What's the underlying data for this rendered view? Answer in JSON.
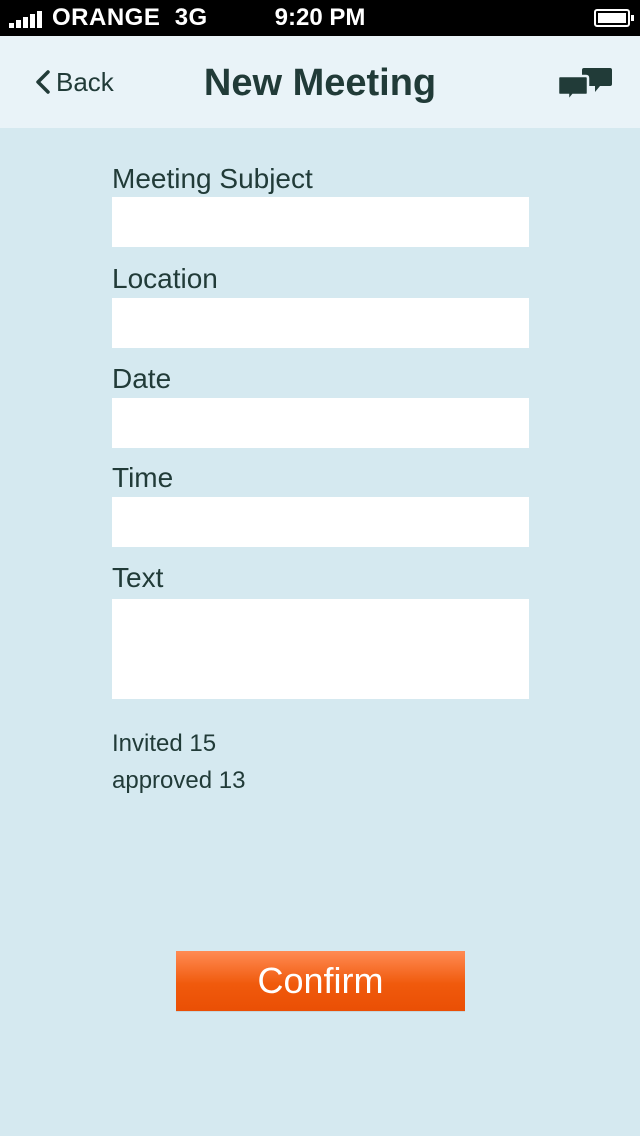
{
  "status_bar": {
    "carrier": "ORANGE",
    "network": "3G",
    "time": "9:20 PM",
    "signal_bars": 5,
    "battery_level": 1.0
  },
  "nav": {
    "back_label": "Back",
    "title": "New Meeting",
    "right_icon": "chat-bubbles-icon"
  },
  "form": {
    "fields": [
      {
        "label": "Meeting Subject",
        "value": "",
        "placeholder": ""
      },
      {
        "label": "Location",
        "value": "",
        "placeholder": ""
      },
      {
        "label": "Date",
        "value": "",
        "placeholder": ""
      },
      {
        "label": "Time",
        "value": "",
        "placeholder": ""
      },
      {
        "label": "Text",
        "value": "",
        "placeholder": ""
      }
    ]
  },
  "stats": {
    "invited": "Invited 15",
    "approved": "approved 13"
  },
  "actions": {
    "confirm_label": "Confirm"
  },
  "colors": {
    "background": "#d5e9f0",
    "nav_background": "#e9f3f8",
    "text": "#213b38",
    "accent": "#f05a0c"
  }
}
